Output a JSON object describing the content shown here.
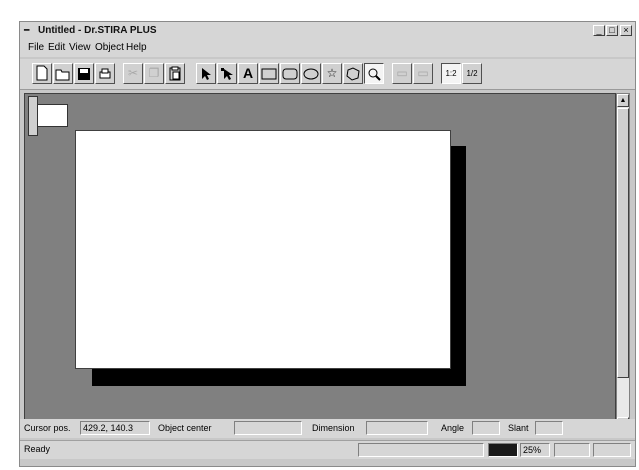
{
  "window": {
    "title": "Untitled - Dr.STIRA PLUS",
    "icon": "app-icon"
  },
  "title_buttons": {
    "minimize": "_",
    "maximize": "□",
    "close": "×"
  },
  "menu": [
    "File",
    "Edit",
    "View",
    "Object",
    "Help"
  ],
  "toolbar": {
    "new": "new-document-icon",
    "open": "open-folder-icon",
    "save": "save-disk-icon",
    "print": "print-icon",
    "cut": "cut-icon",
    "copy": "copy-icon",
    "paste": "paste-icon",
    "select": "arrow-pointer-icon",
    "node": "node-edit-icon",
    "text_glyph": "A",
    "rect": "rectangle-icon",
    "roundrect": "rounded-rectangle-icon",
    "ellipse": "ellipse-icon",
    "star": "star-icon",
    "polygon": "polygon-icon",
    "zoom": "magnifier-icon",
    "zoom_ratio_label": "1:2",
    "fraction_label": "1/2"
  },
  "status": {
    "cursor_label": "Cursor pos.",
    "cursor_value": "429.2, 140.3",
    "center_label": "Object center",
    "center_value": "",
    "dimension_label": "Dimension",
    "dimension_value": "",
    "angle_label": "Angle",
    "angle_value": "",
    "slant_label": "Slant",
    "slant_value": "",
    "ready": "Ready",
    "zoom": "25%"
  },
  "colors": {
    "canvas": "#808080",
    "page": "#ffffff",
    "shadow": "#000000",
    "chrome": "#d6d6d6"
  }
}
